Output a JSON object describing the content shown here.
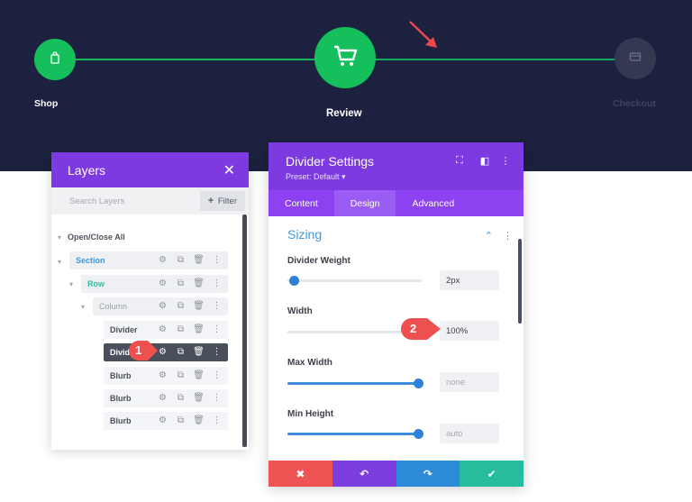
{
  "colors": {
    "hero_bg": "#1c2140",
    "step_green": "#15b95a",
    "purple": "#7c3ae0",
    "tab_purple": "#8c42f0",
    "accent_blue": "#3f97dc",
    "badge_red": "#ee4f4f",
    "footer": [
      "#ef5455",
      "#7d3ee0",
      "#2d8ad9",
      "#27bc9e"
    ]
  },
  "stepper": {
    "steps": [
      {
        "label": "Shop",
        "icon": "shopping-bag-icon",
        "state": "done"
      },
      {
        "label": "Review",
        "icon": "shopping-cart-icon",
        "state": "current"
      },
      {
        "label": "Checkout",
        "icon": "credit-card-icon",
        "state": "upcoming"
      }
    ]
  },
  "layers": {
    "title": "Layers",
    "search_placeholder": "Search Layers",
    "filter_label": "Filter",
    "toggle_all": "Open/Close All",
    "items": [
      {
        "label": "Section",
        "level": "section"
      },
      {
        "label": "Row",
        "level": "row"
      },
      {
        "label": "Column",
        "level": "column"
      },
      {
        "label": "Divider",
        "level": "module"
      },
      {
        "label": "Divider",
        "level": "module",
        "state": "hover"
      },
      {
        "label": "Blurb",
        "level": "module"
      },
      {
        "label": "Blurb",
        "level": "module"
      },
      {
        "label": "Blurb",
        "level": "module"
      }
    ]
  },
  "badges": {
    "one": "1",
    "two": "2"
  },
  "settings": {
    "title": "Divider Settings",
    "preset": "Preset: Default ▾",
    "tabs": [
      "Content",
      "Design",
      "Advanced"
    ],
    "active_tab": "Design",
    "section_title": "Sizing",
    "fields": [
      {
        "label": "Divider Weight",
        "value": "2px",
        "slider_fraction": 0.0
      },
      {
        "label": "Width",
        "value": "100%",
        "slider_fraction": 1.0
      },
      {
        "label": "Max Width",
        "value": "none",
        "slider_fraction": 1.0
      },
      {
        "label": "Min Height",
        "value": "auto",
        "slider_fraction": 1.0
      }
    ]
  },
  "footer": {
    "cancel": "✖",
    "undo": "↶",
    "redo": "↷",
    "save": "✔"
  }
}
